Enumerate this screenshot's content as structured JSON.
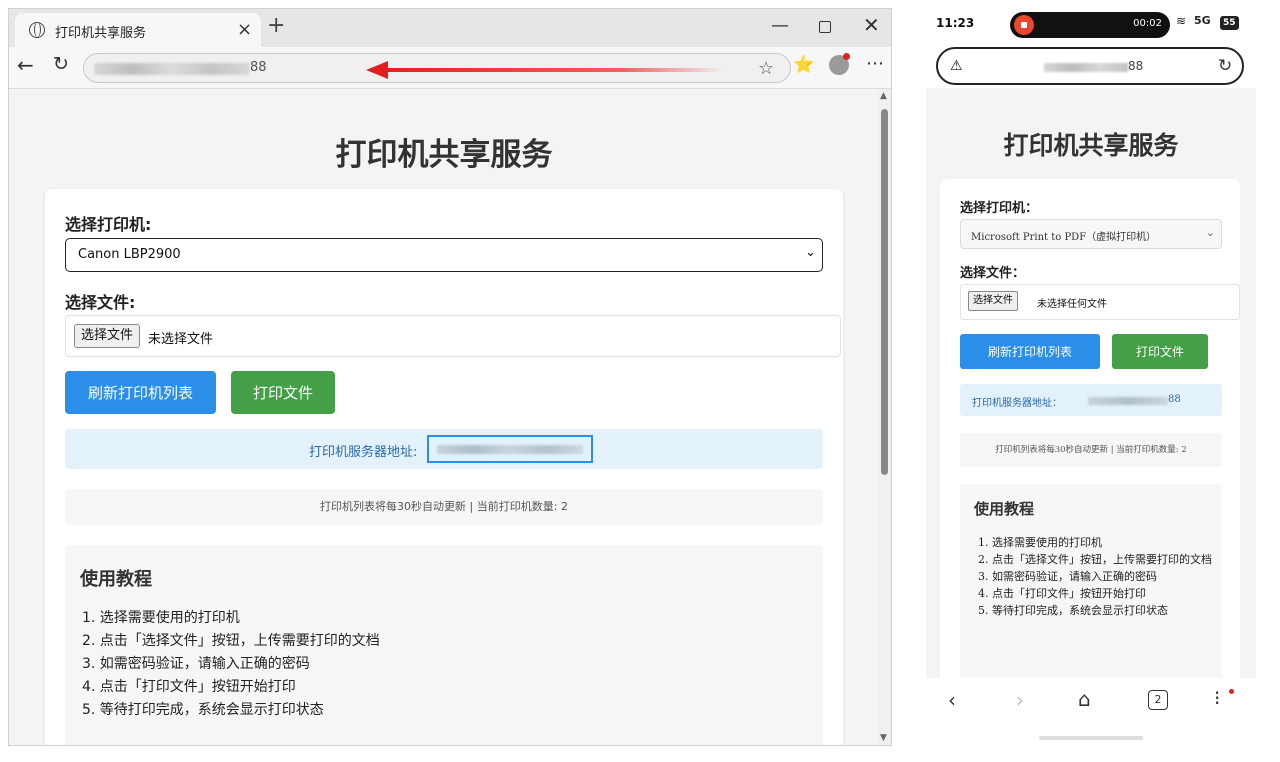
{
  "desktop": {
    "tab": {
      "title": "打印机共享服务",
      "close": "×",
      "new": "+"
    },
    "window": {
      "minimize": "—",
      "close": "✕"
    },
    "nav": {
      "back": "←",
      "reload": "↻",
      "url_tail": "88",
      "star": "☆",
      "favorites": "⭐",
      "more": "⋯"
    },
    "page": {
      "title": "打印机共享服务",
      "select_printer_label": "选择打印机:",
      "selected_printer": "Canon LBP2900",
      "select_file_label": "选择文件:",
      "file_button": "选择文件",
      "no_file": "未选择文件",
      "refresh_button": "刷新打印机列表",
      "print_button": "打印文件",
      "server_label": "打印机服务器地址:",
      "status": "打印机列表将每30秒自动更新 | 当前打印机数量: 2",
      "tutorial_title": "使用教程",
      "tutorial_steps": [
        "1. 选择需要使用的打印机",
        "2. 点击「选择文件」按钮，上传需要打印的文档",
        "3. 如需密码验证，请输入正确的密码",
        "4. 点击「打印文件」按钮开始打印",
        "5. 等待打印完成，系统会显示打印状态"
      ]
    }
  },
  "mobile": {
    "status_bar": {
      "time": "11:23",
      "recording_time": "00:02",
      "signal": "5G",
      "battery": "55"
    },
    "url_tail": "88",
    "page": {
      "title": "打印机共享服务",
      "select_printer_label": "选择打印机：",
      "selected_printer": "Microsoft Print to PDF（虚拟打印机）",
      "select_file_label": "选择文件：",
      "file_button": "选择文件",
      "no_file": "未选择任何文件",
      "refresh_button": "刷新打印机列表",
      "print_button": "打印文件",
      "server_label": "打印机服务器地址：",
      "server_tail": "88",
      "status": "打印机列表将每30秒自动更新 | 当前打印机数量: 2",
      "tutorial_title": "使用教程",
      "tutorial_steps": [
        "1. 选择需要使用的打印机",
        "2. 点击「选择文件」按钮，上传需要打印的文档",
        "3. 如需密码验证，请输入正确的密码",
        "4. 点击「打印文件」按钮开始打印",
        "5. 等待打印完成，系统会显示打印状态"
      ]
    },
    "nav": {
      "back": "‹",
      "forward": "›",
      "home": "⌂",
      "tabs": "2",
      "menu": "⁝"
    }
  },
  "colors": {
    "primary": "#2b8ee8",
    "success": "#43a047",
    "annotation": "#e02020"
  }
}
